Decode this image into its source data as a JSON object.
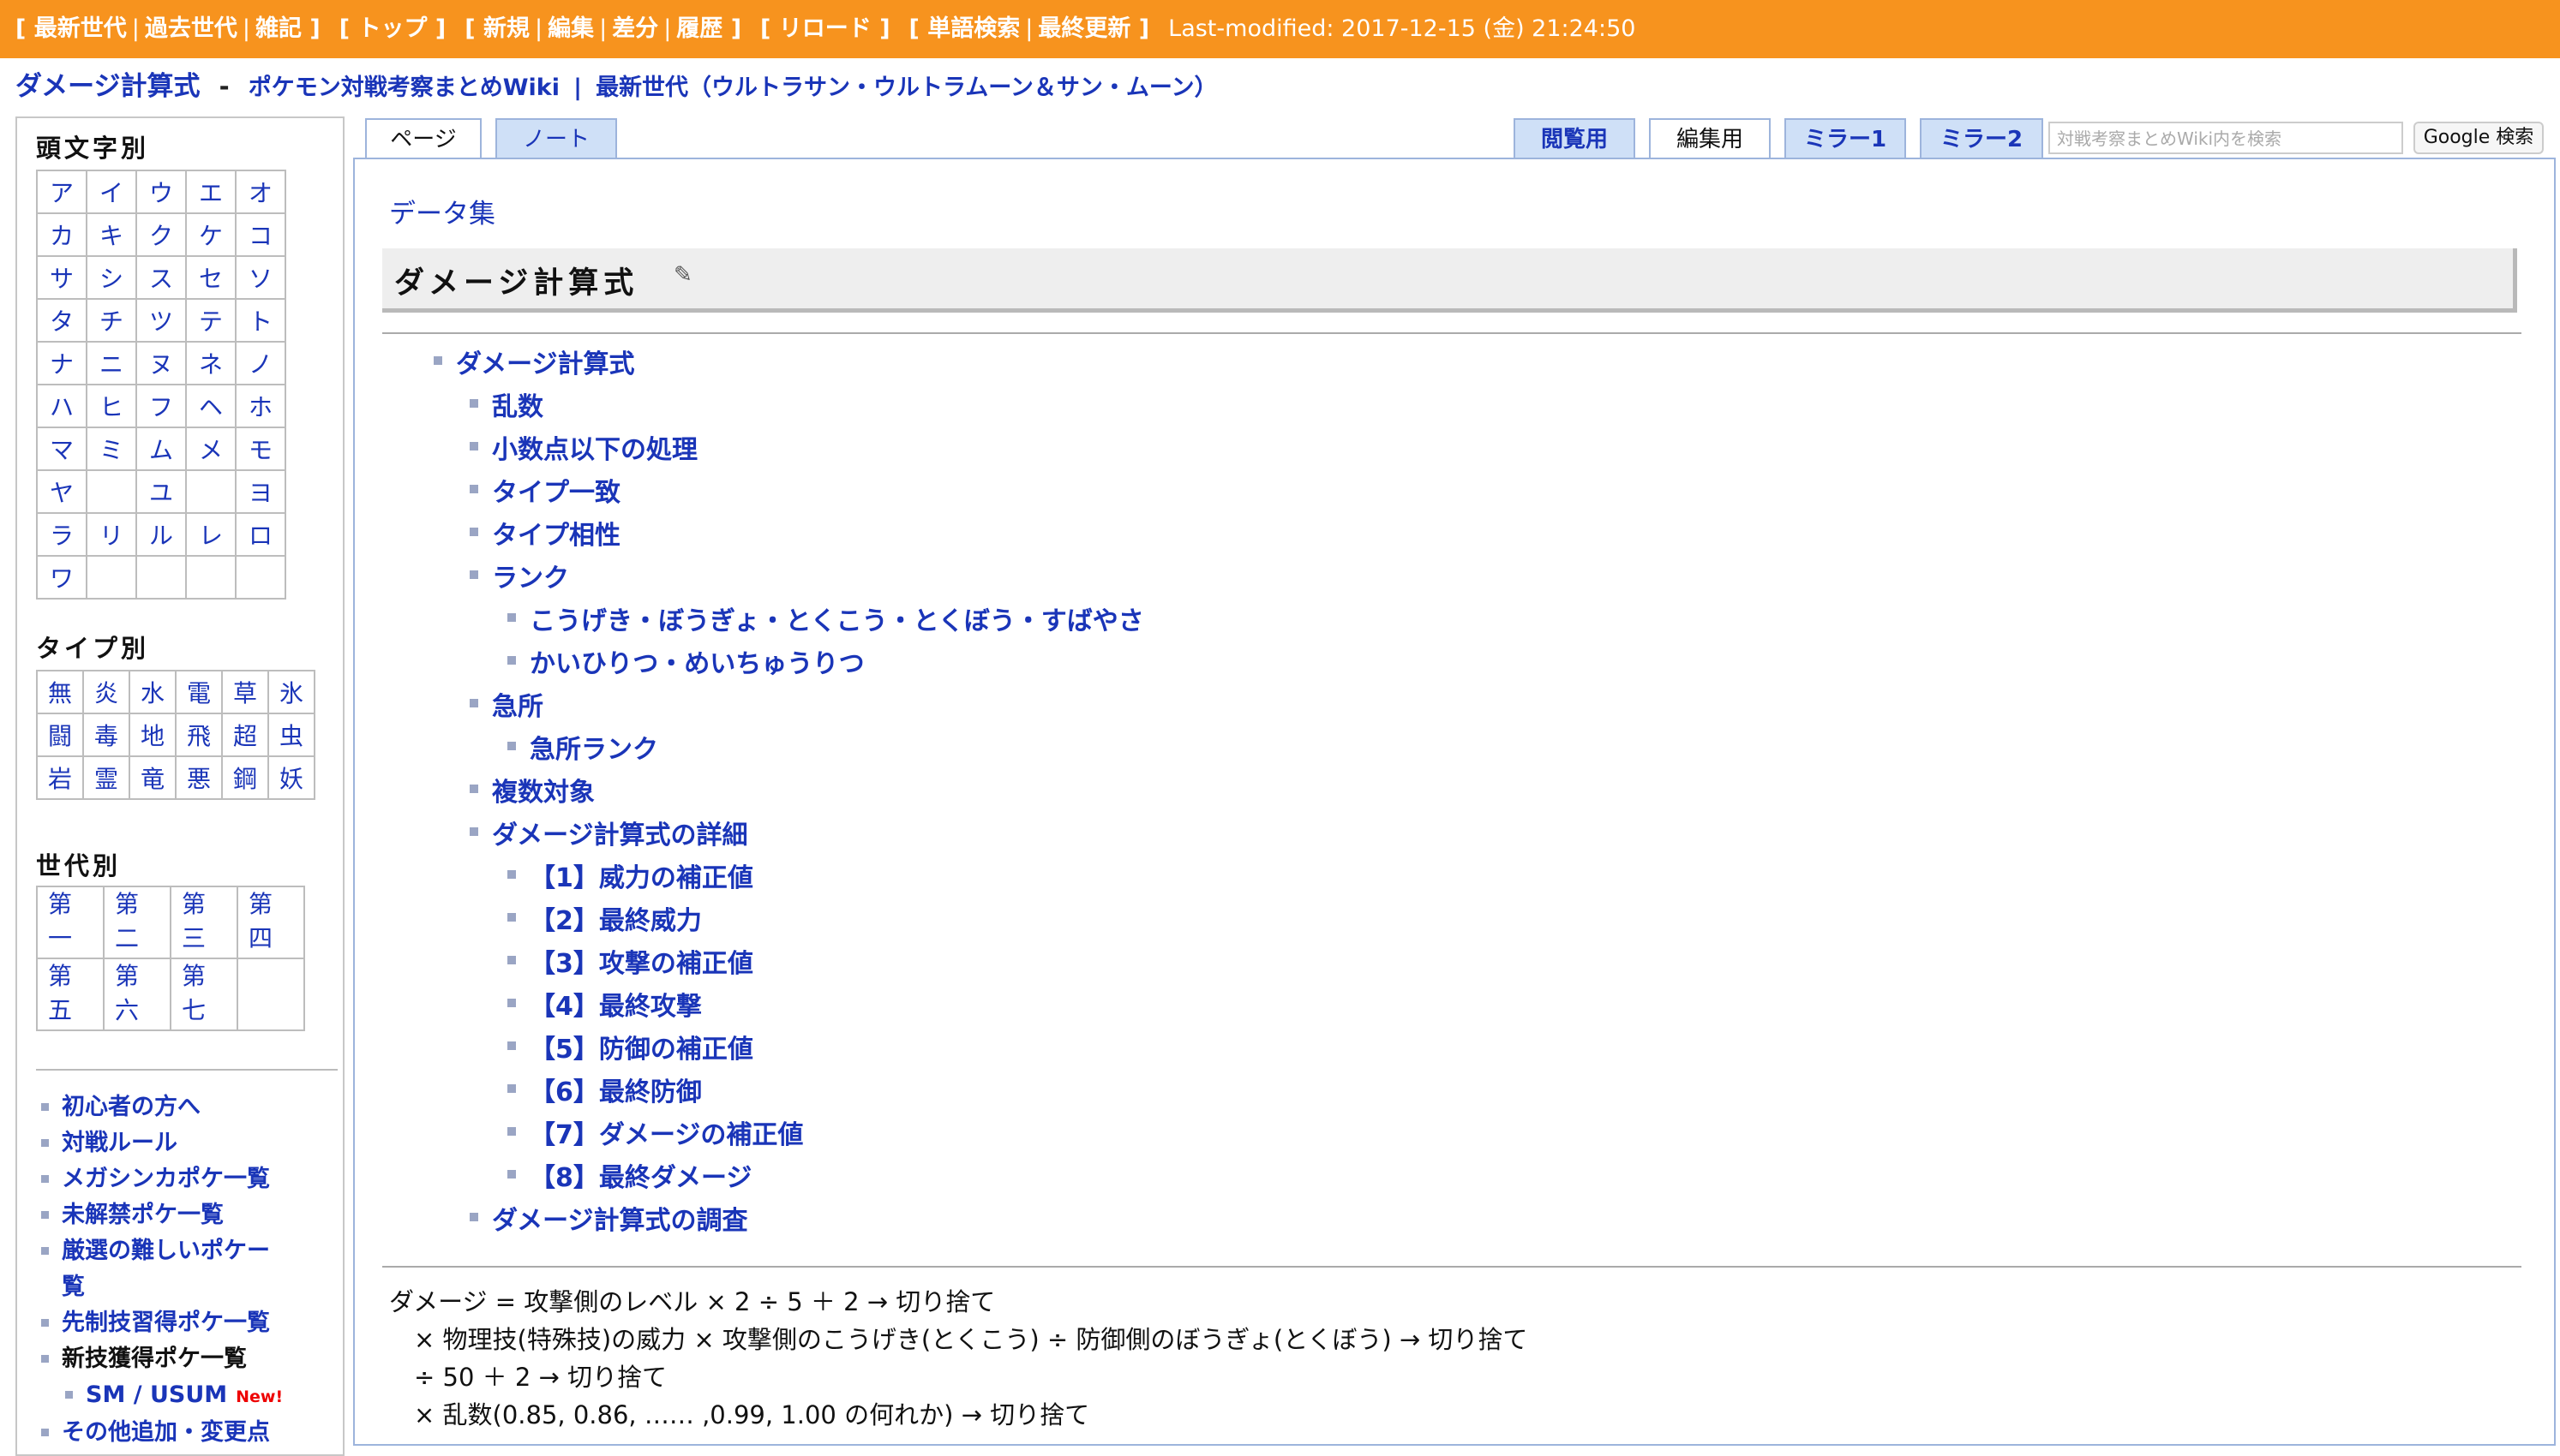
{
  "topbar": {
    "groups": [
      [
        "最新世代",
        "過去世代",
        "雑記"
      ],
      [
        "トップ"
      ],
      [
        "新規",
        "編集",
        "差分",
        "履歴"
      ],
      [
        "リロード"
      ],
      [
        "単語検索",
        "最終更新"
      ]
    ],
    "last_modified": "Last-modified: 2017-12-15 (金) 21:24:50"
  },
  "title": {
    "page": "ダメージ計算式",
    "dash": "-",
    "site": "ポケモン対戦考察まとめWiki",
    "bar": "|",
    "section": "最新世代（ウルトラサン・ウルトラムーン＆サン・ムーン）"
  },
  "sidebar": {
    "kana_heading": "頭文字別",
    "kana": [
      [
        "ア",
        "イ",
        "ウ",
        "エ",
        "オ"
      ],
      [
        "カ",
        "キ",
        "ク",
        "ケ",
        "コ"
      ],
      [
        "サ",
        "シ",
        "ス",
        "セ",
        "ソ"
      ],
      [
        "タ",
        "チ",
        "ツ",
        "テ",
        "ト"
      ],
      [
        "ナ",
        "ニ",
        "ヌ",
        "ネ",
        "ノ"
      ],
      [
        "ハ",
        "ヒ",
        "フ",
        "ヘ",
        "ホ"
      ],
      [
        "マ",
        "ミ",
        "ム",
        "メ",
        "モ"
      ],
      [
        "ヤ",
        "",
        "ユ",
        "",
        "ヨ"
      ],
      [
        "ラ",
        "リ",
        "ル",
        "レ",
        "ロ"
      ],
      [
        "ワ",
        "",
        "",
        "",
        ""
      ]
    ],
    "type_heading": "タイプ別",
    "types": [
      [
        "無",
        "炎",
        "水",
        "電",
        "草",
        "氷"
      ],
      [
        "闘",
        "毒",
        "地",
        "飛",
        "超",
        "虫"
      ],
      [
        "岩",
        "霊",
        "竜",
        "悪",
        "鋼",
        "妖"
      ]
    ],
    "gen_heading": "世代別",
    "gens": [
      [
        [
          "第",
          "一"
        ],
        [
          "第",
          "二"
        ],
        [
          "第",
          "三"
        ],
        [
          "第",
          "四"
        ]
      ],
      [
        [
          "第",
          "五"
        ],
        [
          "第",
          "六"
        ],
        [
          "第",
          "七"
        ],
        [
          "",
          ""
        ]
      ]
    ],
    "links": [
      {
        "label": "初心者の方へ"
      },
      {
        "label": "対戦ルール"
      },
      {
        "label": "メガシンカポケ一覧"
      },
      {
        "label": "未解禁ポケ一覧"
      },
      {
        "label": "厳選の難しいポケー"
      },
      {
        "label": "覧"
      },
      {
        "label": "先制技習得ポケ一覧"
      },
      {
        "label": "新技獲得ポケ一覧"
      },
      {
        "label": "SM / USUM",
        "badge": "New!"
      },
      {
        "label": "その他追加・変更点"
      }
    ]
  },
  "tabs": {
    "page": "ページ",
    "note": "ノート",
    "view": "閲覧用",
    "edit": "編集用",
    "mirror1": "ミラー1",
    "mirror2": "ミラー2",
    "search_placeholder": "対戦考察まとめWiki内を検索",
    "google": "Google 検索"
  },
  "content": {
    "breadcrumb": "データ集",
    "heading": "ダメージ計算式",
    "toc": [
      {
        "label": "ダメージ計算式",
        "level": 1
      },
      {
        "label": "乱数",
        "level": 2
      },
      {
        "label": "小数点以下の処理",
        "level": 2
      },
      {
        "label": "タイプ一致",
        "level": 2
      },
      {
        "label": "タイプ相性",
        "level": 2
      },
      {
        "label": "ランク",
        "level": 2
      },
      {
        "label": "こうげき・ぼうぎょ・とくこう・とくぼう・すばやさ",
        "level": 3
      },
      {
        "label": "かいひりつ・めいちゅうりつ",
        "level": 3
      },
      {
        "label": "急所",
        "level": 2
      },
      {
        "label": "急所ランク",
        "level": 3
      },
      {
        "label": "複数対象",
        "level": 2
      },
      {
        "label": "ダメージ計算式の詳細",
        "level": 2
      },
      {
        "label": "【1】威力の補正値",
        "level": 3
      },
      {
        "label": "【2】最終威力",
        "level": 3
      },
      {
        "label": "【3】攻撃の補正値",
        "level": 3
      },
      {
        "label": "【4】最終攻撃",
        "level": 3
      },
      {
        "label": "【5】防御の補正値",
        "level": 3
      },
      {
        "label": "【6】最終防御",
        "level": 3
      },
      {
        "label": "【7】ダメージの補正値",
        "level": 3
      },
      {
        "label": "【8】最終ダメージ",
        "level": 3
      },
      {
        "label": "ダメージ計算式の調査",
        "level": 2
      }
    ],
    "formula": [
      "ダメージ = 攻撃側のレベル × 2 ÷ 5 ＋ 2 → 切り捨て",
      "　× 物理技(特殊技)の威力 × 攻撃側のこうげき(とくこう) ÷ 防御側のぼうぎょ(とくぼう) → 切り捨て",
      "　÷ 50 ＋ 2 → 切り捨て",
      "　× 乱数(0.85, 0.86, …… ,0.99, 1.00 の何れか) → 切り捨て"
    ]
  }
}
